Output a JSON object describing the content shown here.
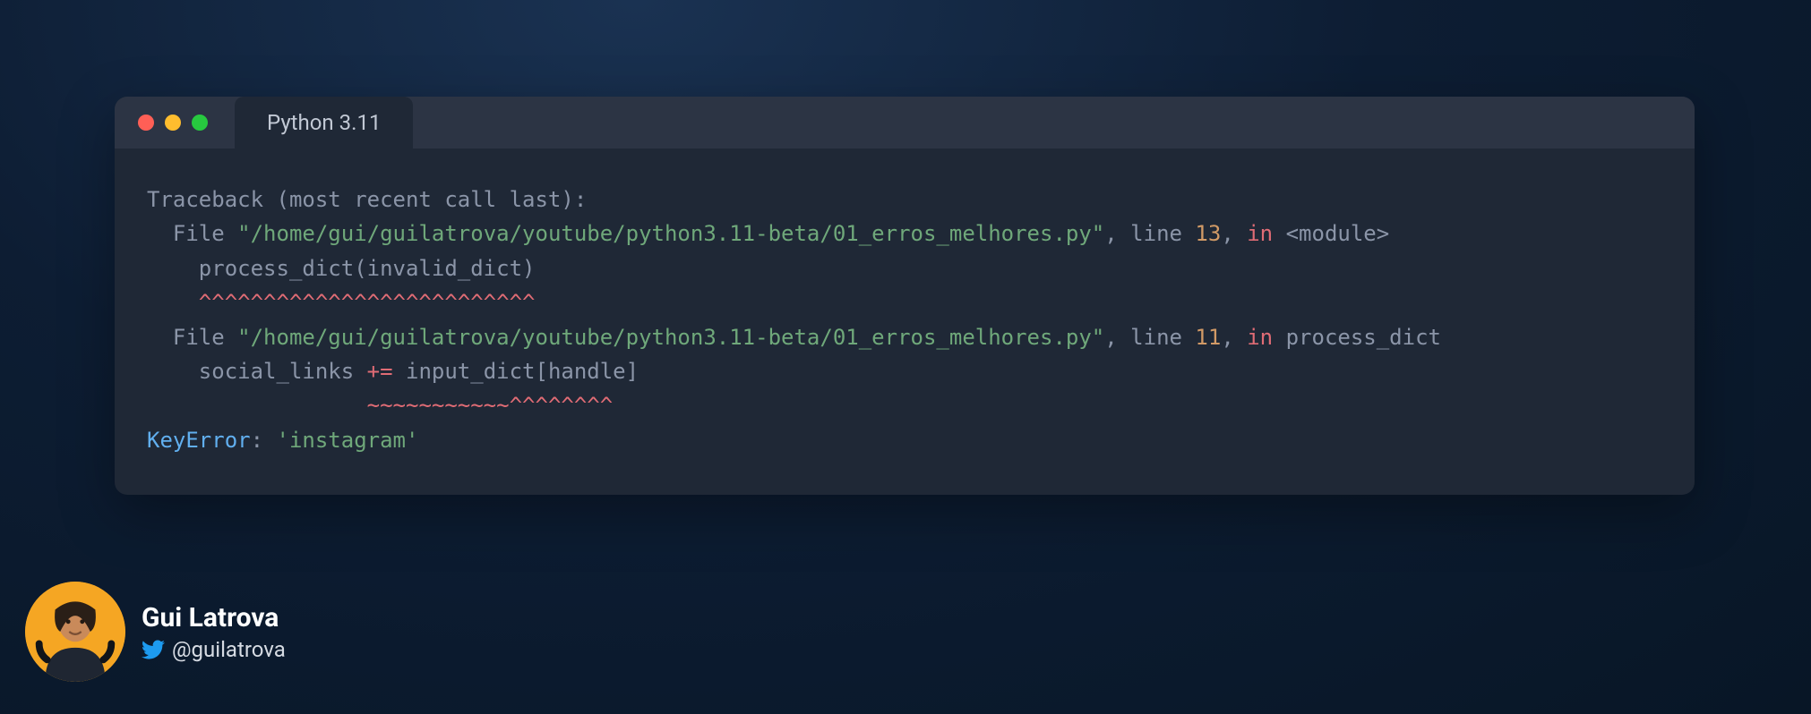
{
  "window": {
    "tab_label": "Python 3.11",
    "traffic_light_colors": {
      "red": "#ff5f56",
      "yellow": "#ffbd2e",
      "green": "#27c93f"
    }
  },
  "traceback": {
    "header": "Traceback (most recent call last):",
    "frames": [
      {
        "file_prefix": "  File ",
        "path": "\"/home/gui/guilatrova/youtube/python3.11-beta/01_erros_melhores.py\"",
        "line_prefix": ", line ",
        "line_no": "13",
        "in_prefix": ", ",
        "in_kw": "in",
        "scope": " <module>",
        "code_indent": "    ",
        "code": "process_dict(invalid_dict)",
        "underline_indent": "    ",
        "underline": "^^^^^^^^^^^^^^^^^^^^^^^^^^"
      },
      {
        "file_prefix": "  File ",
        "path": "\"/home/gui/guilatrova/youtube/python3.11-beta/01_erros_melhores.py\"",
        "line_prefix": ", line ",
        "line_no": "11",
        "in_prefix": ", ",
        "in_kw": "in",
        "scope": " process_dict",
        "code_indent": "    ",
        "code_left": "social_links ",
        "code_op": "+=",
        "code_right": " input_dict[handle]",
        "underline_indent": "                 ",
        "underline_tilde": "~~~~~~~~~~~",
        "underline_caret": "^^^^^^^^"
      }
    ],
    "error_type": "KeyError",
    "error_sep": ": ",
    "error_msg": "'instagram'"
  },
  "profile": {
    "name": "Gui Latrova",
    "handle": "@guilatrova"
  }
}
